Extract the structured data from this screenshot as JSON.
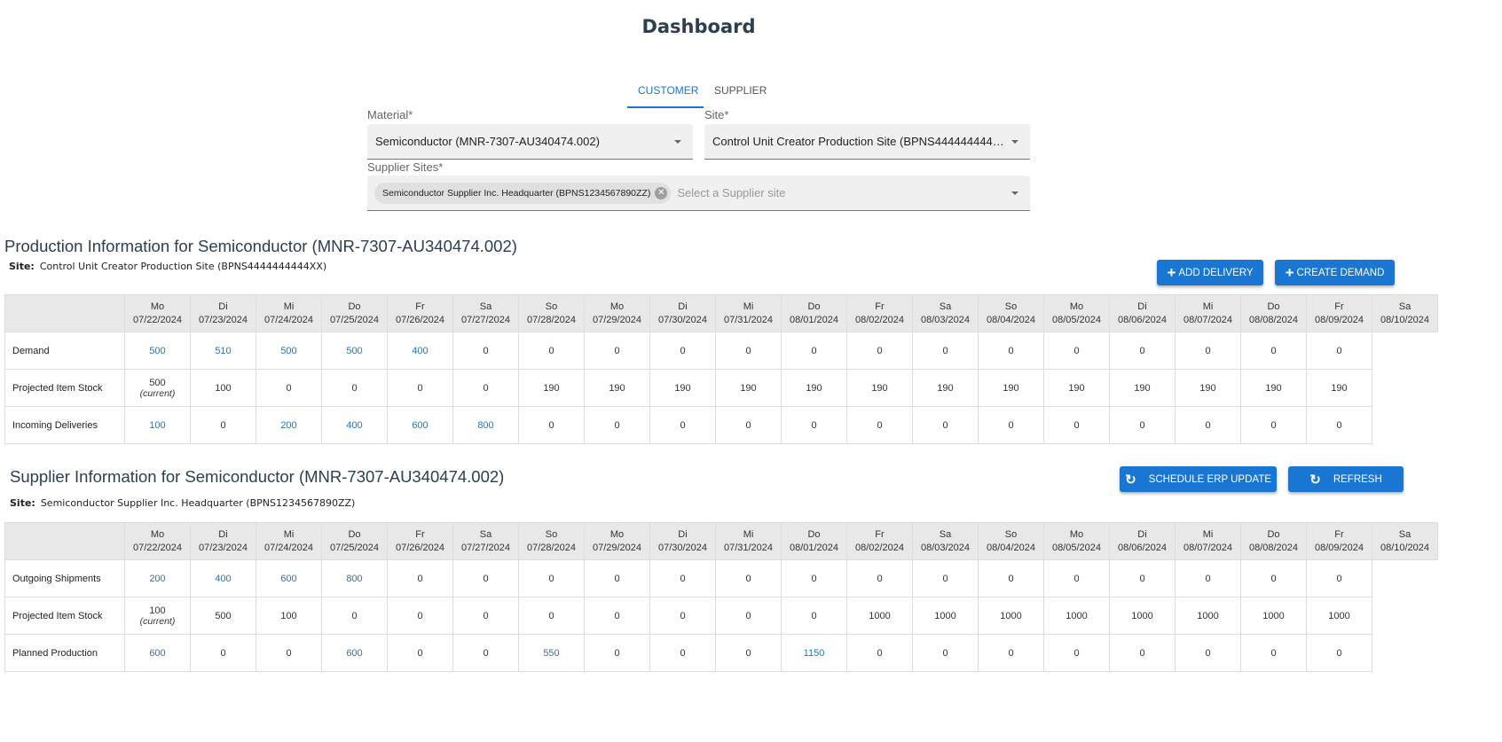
{
  "page_title": "Dashboard",
  "tabs": [
    {
      "label": "CUSTOMER",
      "active": true
    },
    {
      "label": "SUPPLIER",
      "active": false
    }
  ],
  "form": {
    "material_label": "Material*",
    "material_value": "Semiconductor (MNR-7307-AU340474.002)",
    "site_label": "Site*",
    "site_value": "Control Unit Creator Production Site (BPNS444444444 ...",
    "supplier_sites_label": "Supplier Sites*",
    "supplier_chip": "Semiconductor Supplier Inc. Headquarter (BPNS1234567890ZZ)",
    "supplier_placeholder": "Select a Supplier site"
  },
  "production": {
    "title": "Production Information for Semiconductor (MNR-7307-AU340474.002)",
    "site_label": "Site:",
    "site_value": "Control Unit Creator Production Site (BPNS4444444444XX)",
    "add_delivery": "ADD DELIVERY",
    "create_demand": "CREATE DEMAND",
    "rows": [
      {
        "label": "Demand",
        "values": [
          "500",
          "510",
          "500",
          "500",
          "400",
          "0",
          "0",
          "0",
          "0",
          "0",
          "0",
          "0",
          "0",
          "0",
          "0",
          "0",
          "0",
          "0",
          "0"
        ],
        "links": [
          0,
          1,
          2,
          3,
          4
        ]
      },
      {
        "label": "Projected Item Stock",
        "values": [
          "500",
          "100",
          "0",
          "0",
          "0",
          "0",
          "190",
          "190",
          "190",
          "190",
          "190",
          "190",
          "190",
          "190",
          "190",
          "190",
          "190",
          "190",
          "190"
        ],
        "links": [],
        "current": "(current)"
      },
      {
        "label": "Incoming Deliveries",
        "values": [
          "100",
          "0",
          "200",
          "400",
          "600",
          "800",
          "0",
          "0",
          "0",
          "0",
          "0",
          "0",
          "0",
          "0",
          "0",
          "0",
          "0",
          "0",
          "0"
        ],
        "links": [
          0,
          2,
          3,
          4,
          5
        ]
      }
    ]
  },
  "supplier": {
    "title": "Supplier Information for Semiconductor (MNR-7307-AU340474.002)",
    "site_label": "Site:",
    "site_value": "Semiconductor Supplier Inc. Headquarter (BPNS1234567890ZZ)",
    "schedule_erp": "SCHEDULE ERP UPDATE",
    "refresh": "REFRESH",
    "rows": [
      {
        "label": "Outgoing Shipments",
        "values": [
          "200",
          "400",
          "600",
          "800",
          "0",
          "0",
          "0",
          "0",
          "0",
          "0",
          "0",
          "0",
          "0",
          "0",
          "0",
          "0",
          "0",
          "0",
          "0"
        ],
        "links": [
          0,
          1,
          2,
          3
        ]
      },
      {
        "label": "Projected Item Stock",
        "values": [
          "100",
          "500",
          "100",
          "0",
          "0",
          "0",
          "0",
          "0",
          "0",
          "0",
          "0",
          "1000",
          "1000",
          "1000",
          "1000",
          "1000",
          "1000",
          "1000",
          "1000"
        ],
        "links": [],
        "current": "(current)"
      },
      {
        "label": "Planned Production",
        "values": [
          "600",
          "0",
          "0",
          "600",
          "0",
          "0",
          "550",
          "0",
          "0",
          "0",
          "1150",
          "0",
          "0",
          "0",
          "0",
          "0",
          "0",
          "0",
          "0"
        ],
        "links": [
          0,
          3,
          6,
          10
        ]
      }
    ]
  },
  "days": [
    {
      "d": "Mo",
      "date": "07/22/2024"
    },
    {
      "d": "Di",
      "date": "07/23/2024"
    },
    {
      "d": "Mi",
      "date": "07/24/2024"
    },
    {
      "d": "Do",
      "date": "07/25/2024"
    },
    {
      "d": "Fr",
      "date": "07/26/2024"
    },
    {
      "d": "Sa",
      "date": "07/27/2024"
    },
    {
      "d": "So",
      "date": "07/28/2024"
    },
    {
      "d": "Mo",
      "date": "07/29/2024"
    },
    {
      "d": "Di",
      "date": "07/30/2024"
    },
    {
      "d": "Mi",
      "date": "07/31/2024"
    },
    {
      "d": "Do",
      "date": "08/01/2024"
    },
    {
      "d": "Fr",
      "date": "08/02/2024"
    },
    {
      "d": "Sa",
      "date": "08/03/2024"
    },
    {
      "d": "So",
      "date": "08/04/2024"
    },
    {
      "d": "Mo",
      "date": "08/05/2024"
    },
    {
      "d": "Di",
      "date": "08/06/2024"
    },
    {
      "d": "Mi",
      "date": "08/07/2024"
    },
    {
      "d": "Do",
      "date": "08/08/2024"
    },
    {
      "d": "Fr",
      "date": "08/09/2024"
    },
    {
      "d": "Sa",
      "date": "08/10/2024"
    }
  ],
  "colors": {
    "accent": "#1976d2",
    "header_bg": "#e8e8e8"
  }
}
